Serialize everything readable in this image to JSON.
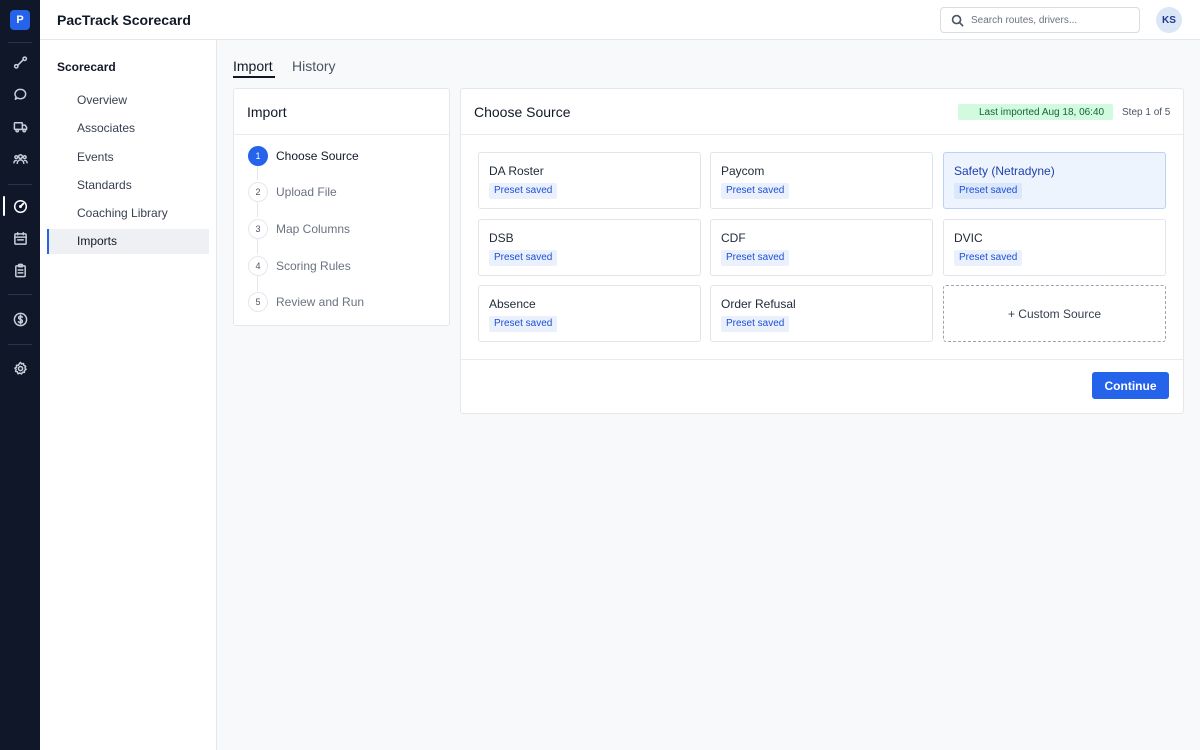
{
  "app": {
    "logo_letter": "P",
    "title": "PacTrack Scorecard"
  },
  "rail": {
    "icons": [
      "route-icon",
      "message-icon",
      "truck-icon",
      "team-icon",
      "scorecard-gauge-icon",
      "calendar-icon",
      "clipboard-icon",
      "payroll-dollar-icon",
      "settings-gear-icon"
    ],
    "active": "scorecard-gauge-icon"
  },
  "search": {
    "placeholder": "Search routes, drivers..."
  },
  "user": {
    "initials": "KS"
  },
  "subnav": {
    "title": "Scorecard",
    "items": [
      {
        "label": "Overview"
      },
      {
        "label": "Associates"
      },
      {
        "label": "Events"
      },
      {
        "label": "Standards"
      },
      {
        "label": "Coaching Library"
      },
      {
        "label": "Imports",
        "active": true
      }
    ]
  },
  "tabs": [
    {
      "label": "Import",
      "active": true
    },
    {
      "label": "History"
    }
  ],
  "stepper": {
    "title": "Import",
    "steps": [
      {
        "num": "1",
        "label": "Choose Source",
        "active": true
      },
      {
        "num": "2",
        "label": "Upload File"
      },
      {
        "num": "3",
        "label": "Map Columns"
      },
      {
        "num": "4",
        "label": "Scoring Rules"
      },
      {
        "num": "5",
        "label": "Review and Run"
      }
    ]
  },
  "source_panel": {
    "title": "Choose Source",
    "last_imported": "Last imported Aug 18, 06:40",
    "step_count": "Step 1 of 5",
    "sources": [
      {
        "name": "DA Roster",
        "badge": "Preset saved"
      },
      {
        "name": "Paycom",
        "badge": "Preset saved"
      },
      {
        "name": "Safety (Netradyne)",
        "badge": "Preset saved",
        "selected": true
      },
      {
        "name": "DSB",
        "badge": "Preset saved"
      },
      {
        "name": "CDF",
        "badge": "Preset saved"
      },
      {
        "name": "DVIC",
        "badge": "Preset saved"
      },
      {
        "name": "Absence",
        "badge": "Preset saved"
      },
      {
        "name": "Order Refusal",
        "badge": "Preset saved"
      }
    ],
    "custom_source_label": "+ Custom Source",
    "continue_label": "Continue"
  },
  "colors": {
    "accent": "#2563eb",
    "rail_bg": "#0f1729",
    "success_bg": "#d1fadf"
  }
}
